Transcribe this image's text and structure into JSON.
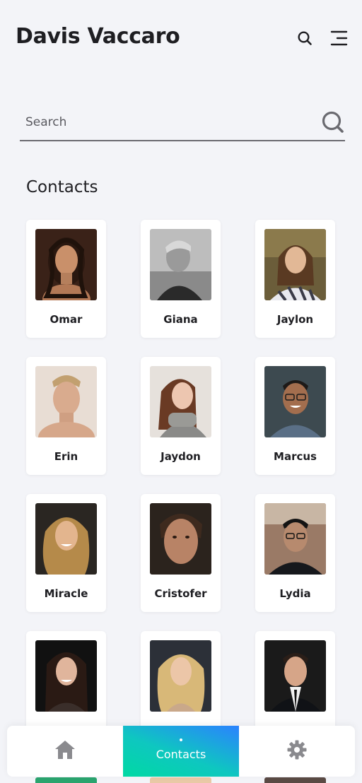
{
  "header": {
    "title": "Davis Vaccaro",
    "search_icon": "search-icon",
    "menu_icon": "menu-icon"
  },
  "search": {
    "placeholder": "Search",
    "value": ""
  },
  "contacts_section": {
    "title": "Contacts",
    "items": [
      {
        "name": "Omar"
      },
      {
        "name": "Giana"
      },
      {
        "name": "Jaylon"
      },
      {
        "name": "Erin"
      },
      {
        "name": "Jaydon"
      },
      {
        "name": "Marcus"
      },
      {
        "name": "Miracle"
      },
      {
        "name": "Cristofer"
      },
      {
        "name": "Lydia"
      },
      {
        "name": ""
      },
      {
        "name": ""
      },
      {
        "name": ""
      }
    ]
  },
  "bottom_nav": {
    "items": [
      {
        "label": "",
        "icon": "home-icon",
        "active": false
      },
      {
        "label": "Contacts",
        "icon": "",
        "active": true
      },
      {
        "label": "",
        "icon": "gear-icon",
        "active": false
      }
    ]
  },
  "colors": {
    "background": "#f3f4f8",
    "card": "#ffffff",
    "text": "#1e1e22",
    "accent_gradient_start": "#00d9a3",
    "accent_gradient_end": "#2b82ff",
    "icon_gray": "#8a8a8e"
  }
}
